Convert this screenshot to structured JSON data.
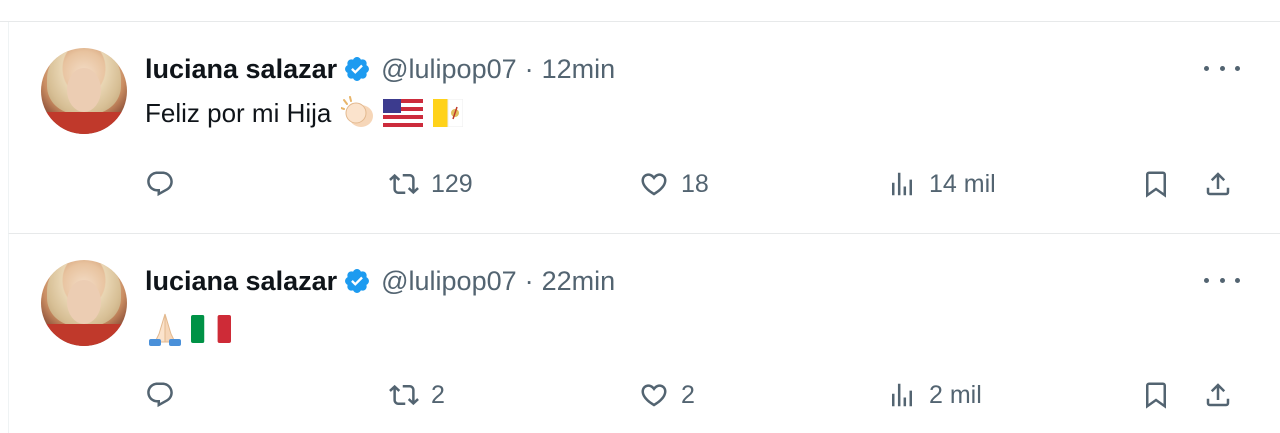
{
  "tweets": [
    {
      "author": {
        "name": "luciana salazar",
        "handle": "@lulipop07",
        "verified": true,
        "avatar": "avatar-photo"
      },
      "separator": "·",
      "time": "12min",
      "text": "Feliz por mi Hija",
      "emojis": [
        "clapping-hands",
        "us-flag",
        "vatican-flag"
      ],
      "stats": {
        "replies": "",
        "retweets": "129",
        "likes": "18",
        "views": "14 mil"
      }
    },
    {
      "author": {
        "name": "luciana salazar",
        "handle": "@lulipop07",
        "verified": true,
        "avatar": "avatar-photo"
      },
      "separator": "·",
      "time": "22min",
      "text": "",
      "emojis": [
        "folded-hands",
        "italy-flag"
      ],
      "stats": {
        "replies": "",
        "retweets": "2",
        "likes": "2",
        "views": "2 mil"
      }
    }
  ],
  "colors": {
    "text_primary": "#0f1419",
    "text_secondary": "#536471",
    "verified_blue": "#1d9bf0",
    "divider": "#e7e9ea"
  }
}
